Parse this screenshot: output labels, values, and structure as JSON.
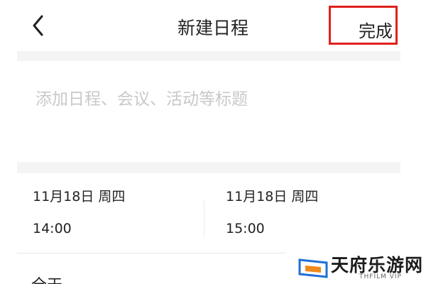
{
  "header": {
    "back_icon": "chevron-left-icon",
    "title": "新建日程",
    "done_label": "完成",
    "highlight_color": "#e0201c"
  },
  "event_title": {
    "placeholder": "添加日程、会议、活动等标题"
  },
  "start": {
    "date": "11月18日 周四",
    "time": "14:00"
  },
  "end": {
    "date": "11月18日 周四",
    "time": "15:00"
  },
  "all_day_label": "全天",
  "watermark": {
    "name": "天府乐游网",
    "sub": "THFILM VIP"
  }
}
